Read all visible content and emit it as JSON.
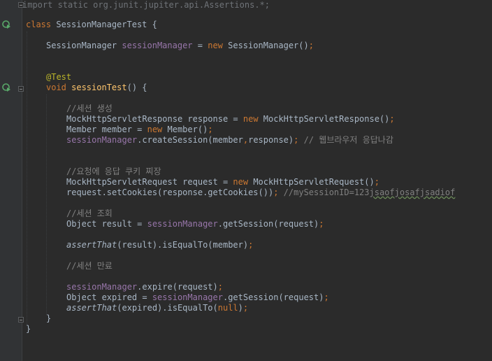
{
  "editor": {
    "line1": {
      "import_text": "import static org.junit.jupiter.api.Assertions.*;"
    },
    "line2": {
      "kw": "class",
      "name": " SessionManagerTest {"
    },
    "line3": {
      "type": "SessionManager ",
      "field": "sessionManager",
      "eq": " = ",
      "kw_new": "new",
      "rest": " SessionManager()",
      "semi": ";"
    },
    "line4": {
      "ann": "@Test"
    },
    "line5": {
      "kw": "void",
      "method": " sessionTest",
      "rest": "() {"
    },
    "line6": {
      "comment": "//세션 생성"
    },
    "line7": {
      "a": "MockHttpServletResponse response = ",
      "kw_new": "new",
      "b": " MockHttpServletResponse()",
      "semi": ";"
    },
    "line8": {
      "a": "Member member = ",
      "kw_new": "new",
      "b": " Member()",
      "semi": ";"
    },
    "line9": {
      "field": "sessionManager",
      "a": ".createSession(member",
      "comma": ",",
      "b": "response)",
      "semi": ";",
      "comment": " // 웹브라우저 응답나감"
    },
    "line10": {
      "comment": "//요청에 응답 쿠키 찌장"
    },
    "line11": {
      "a": "MockHttpServletRequest request = ",
      "kw_new": "new",
      "b": " MockHttpServletRequest()",
      "semi": ";"
    },
    "line12": {
      "a": "request.setCookies(response.getCookies())",
      "semi": ";",
      "comment": " //mySessionID=123",
      "typo": "jsaofjosafjsadiof"
    },
    "line13": {
      "comment": "//세션 조회"
    },
    "line14": {
      "a": "Object result = ",
      "field": "sessionManager",
      "b": ".getSession(request)",
      "semi": ";"
    },
    "line15": {
      "static": "assertThat",
      "a": "(result).isEqualTo(member)",
      "semi": ";"
    },
    "line16": {
      "comment": "//세션 만료"
    },
    "line17": {
      "field": "sessionManager",
      "a": ".expire(request)",
      "semi": ";"
    },
    "line18": {
      "a": "Object expired = ",
      "field": "sessionManager",
      "b": ".getSession(request)",
      "semi": ";"
    },
    "line19": {
      "static": "assertThat",
      "a": "(expired).isEqualTo(",
      "kw_null": "null",
      "b": ")",
      "semi": ";"
    },
    "line20": {
      "text": "}"
    },
    "line21": {
      "text": "}"
    }
  },
  "gutter": {
    "icons": [
      "run-test-class-icon",
      "run-test-method-icon"
    ]
  }
}
